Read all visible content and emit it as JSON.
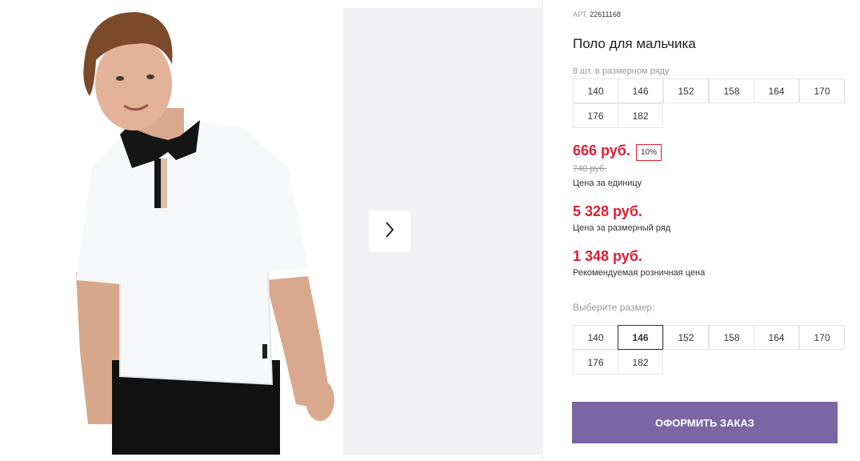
{
  "gallery": {
    "next_icon": "chevron-right-icon"
  },
  "product": {
    "article_label": "АРТ.",
    "article_number": "22611168",
    "title": "Поло для мальчика",
    "row_note": "8 шт. в размерном ряду",
    "row_sizes": [
      "140",
      "146",
      "152",
      "158",
      "164",
      "170",
      "176",
      "182"
    ],
    "price": "666 руб.",
    "discount": "10%",
    "old_price": "740 руб.",
    "unit_price_label": "Цена за единицу",
    "row_price": "5 328 руб.",
    "row_price_label": "Цена за размерный ряд",
    "retail_price": "1 348 руб.",
    "retail_price_label": "Рекомендуемая розничная цена",
    "choose_size_label": "Выберите размер:",
    "sizes": [
      "140",
      "146",
      "152",
      "158",
      "164",
      "170",
      "176",
      "182"
    ],
    "selected_size": "146",
    "order_button": "ОФОРМИТЬ ЗАКАЗ"
  },
  "colors": {
    "accent": "#7a66a3",
    "price_red": "#e31e34"
  }
}
